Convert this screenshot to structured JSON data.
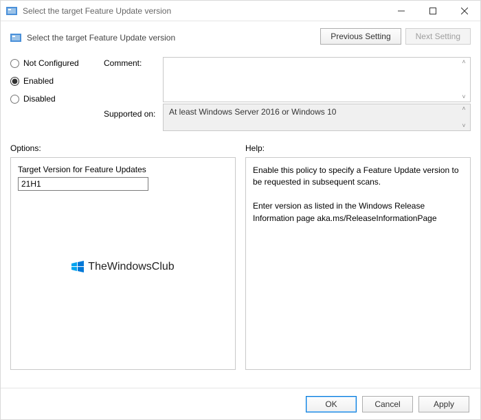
{
  "window": {
    "title": "Select the target Feature Update version"
  },
  "header": {
    "policy_name": "Select the target Feature Update version",
    "prev_btn": "Previous Setting",
    "next_btn": "Next Setting"
  },
  "state": {
    "radios": {
      "not_configured": "Not Configured",
      "enabled": "Enabled",
      "disabled": "Disabled",
      "selected": "enabled"
    },
    "comment_label": "Comment:",
    "comment_value": "",
    "supported_label": "Supported on:",
    "supported_value": "At least Windows Server 2016 or Windows 10"
  },
  "sections": {
    "options_label": "Options:",
    "help_label": "Help:"
  },
  "options": {
    "target_version_label": "Target Version for Feature Updates",
    "target_version_value": "21H1"
  },
  "help": {
    "p1": "Enable this policy to specify a Feature Update version to be requested in subsequent scans.",
    "p2": "Enter version as listed in the Windows Release Information page aka.ms/ReleaseInformationPage"
  },
  "watermark": {
    "text": "TheWindowsClub"
  },
  "footer": {
    "ok": "OK",
    "cancel": "Cancel",
    "apply": "Apply"
  }
}
